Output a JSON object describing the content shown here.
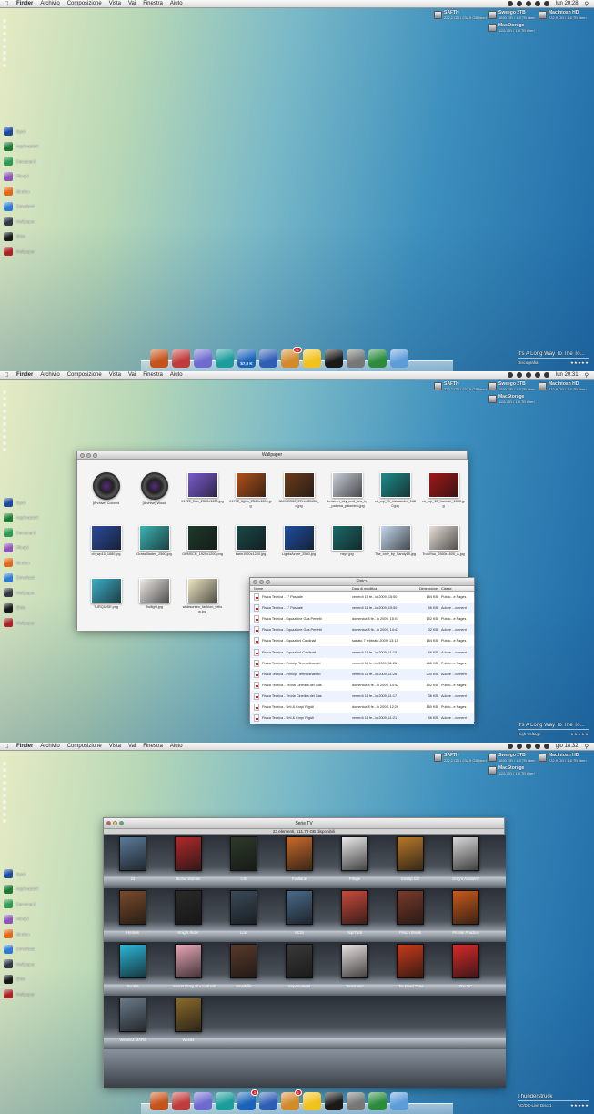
{
  "menubar": {
    "apple": "",
    "items": [
      "Finder",
      "Archivio",
      "Composizione",
      "Vista",
      "Vai",
      "Finestra",
      "Aiuto"
    ],
    "clocks": [
      "lun 20:28",
      "lun 20:31",
      "gio 18:32"
    ]
  },
  "drives": [
    {
      "name": "SAFTH",
      "info": "222,2 GB / 232,9 GB liberi"
    },
    {
      "name": "Sweego 2TB",
      "info": "1850 GB / 1,8 TB liberi"
    },
    {
      "name": "Macintosh HD",
      "info": "232,9 GB / 1,6 TB liberi"
    },
    {
      "name": "MacStorage",
      "info": "1111 GB / 1,8 TB liberi"
    }
  ],
  "sidebar": [
    {
      "label": "Spot!",
      "color": "#1c4a9c"
    },
    {
      "label": "Applicazioni",
      "color": "#1d7a34"
    },
    {
      "label": "Documenti",
      "color": "#2c9c52"
    },
    {
      "label": "Filmati",
      "color": "#8a55b8"
    },
    {
      "label": "Musica",
      "color": "#e06a1c"
    },
    {
      "label": "Download",
      "color": "#2e7bd0"
    },
    {
      "label": "Wallpaper",
      "color": "#333844"
    },
    {
      "label": "Slots",
      "color": "#161616"
    },
    {
      "label": "Wallpaper",
      "color": "#b22222"
    }
  ],
  "dock": {
    "s1_label": "$7,0 K",
    "badge_a": "31",
    "badge_b": "3",
    "badge_c": "1",
    "colors": [
      "#c4531c",
      "#c23b3b",
      "#6e6ad0",
      "#1b9d9b",
      "#1a63b9",
      "#2f5fb5",
      "#d28a2c",
      "#f2c21b",
      "#1a1a1a",
      "#777777",
      "#2c8c3c",
      "#5c9cd8"
    ]
  },
  "music": [
    {
      "title": "It's A Long Way To The To...",
      "artist": "Discografia"
    },
    {
      "title": "It's A Long Way To The To...",
      "artist": "High Voltage"
    },
    {
      "title": "Thunderstruck",
      "artist": "AC/DC-Live Disc 1"
    }
  ],
  "wallpaper_window": {
    "title": "Wallpaper",
    "items": [
      {
        "name": "[Archive] Colored",
        "color": "lens"
      },
      {
        "name": "[Archive] Wood",
        "color": "lens"
      },
      {
        "name": "01721_flow_2560x1600.jpg",
        "color": "#7a5bd0"
      },
      {
        "name": "01792_lights_2560x1600.jpg",
        "color": "#b0501a"
      },
      {
        "name": "384949562_57eb480d54_o.jpg",
        "color": "#6a3c1c"
      },
      {
        "name": "Between_sky_and_sea_by_paloma_palomino.jpg",
        "color": "#c9cfd8"
      },
      {
        "name": "cb_wp_11_cassandra_1680.jpg",
        "color": "#1f8c8c"
      },
      {
        "name": "cb_wp_12_hannah_1680.jpg",
        "color": "#a01818"
      },
      {
        "name": "cb_wp15_1680.jpg",
        "color": "#2a4a9c"
      },
      {
        "name": "GrassBlades_2560.jpg",
        "color": "#3bb5b5"
      },
      {
        "name": "GRNSCR_1920x1200.png",
        "color": "#1d3a2a"
      },
      {
        "name": "karin1920x1200.jpg",
        "color": "#1a4848"
      },
      {
        "name": "LightsAzure_2560.jpg",
        "color": "#1e4ea0"
      },
      {
        "name": "nsye.jpg",
        "color": "#1a6a6a"
      },
      {
        "name": "The_only_by_Sandy15.jpg",
        "color": "#c4d8ec"
      },
      {
        "name": "TrustYou_2560x1600_A.jpg",
        "color": "#e8e0d8"
      },
      {
        "name": "TURQUISE.png",
        "color": "#3cb0c8"
      },
      {
        "name": "Twilight.jpg",
        "color": "#f0ece8"
      },
      {
        "name": "widescreen_fashion_yellow.jpg",
        "color": "#efe8c4"
      }
    ]
  },
  "fisica_window": {
    "title": "Fisica",
    "headers": [
      "Nome",
      "Data di modifica",
      "Dimensione",
      "Classe"
    ],
    "rows": [
      [
        "Fisica Teorica - 1° Parziale",
        "venerdì 13 fe...io 2009, 15:50",
        "184 KB",
        "Public...e Pages"
      ],
      [
        "Fisica Teorica - 1° Parziale",
        "venerdì 13 fe...io 2009, 15:50",
        "56 KB",
        "Adobe ...cument"
      ],
      [
        "Fisica Teorica - Equazione Gas Perfetti",
        "domenica 8 fe...io 2009, 15:01",
        "152 KB",
        "Public...e Pages"
      ],
      [
        "Fisica Teorica - Equazione Gas Perfetti",
        "domenica 8 fe...io 2009, 14:47",
        "32 KB",
        "Adobe ...cument"
      ],
      [
        "Fisica Teorica - Equazioni Cardinali",
        "sabato 7 febbraio 2009, 13:13",
        "184 KB",
        "Public...e Pages"
      ],
      [
        "Fisica Teorica - Equazioni Cardinali",
        "venerdì 13 fe...io 2009, 11:15",
        "56 KB",
        "Adobe ...cument"
      ],
      [
        "Fisica Teorica - Principi Termodinamici",
        "venerdì 13 fe...io 2009, 11:26",
        "468 KB",
        "Public...e Pages"
      ],
      [
        "Fisica Teorica - Principi Termodinamici",
        "venerdì 13 fe...io 2009, 11:26",
        "200 KB",
        "Adobe ...cument"
      ],
      [
        "Fisica Teorica - Teoria Cinetica dei Gas",
        "domenica 8 fe...io 2009, 14:42",
        "152 KB",
        "Public...e Pages"
      ],
      [
        "Fisica Teorica - Teoria Cinetica dei Gas",
        "venerdì 13 fe...io 2009, 11:17",
        "36 KB",
        "Adobe ...cument"
      ],
      [
        "Fisica Teorica - Urti & Corpi Rigidi",
        "domenica 8 fe...io 2009, 12:26",
        "180 KB",
        "Public...e Pages"
      ],
      [
        "Fisica Teorica - Urti & Corpi Rigidi",
        "venerdì 13 fe...io 2009, 11:21",
        "56 KB",
        "Adobe ...cument"
      ]
    ]
  },
  "serie_window": {
    "title": "Serie TV",
    "status": "23 elementi, 511,78 GB disponibili",
    "items": [
      {
        "name": "24",
        "color": "#5a7a9a"
      },
      {
        "name": "Bionic Woman",
        "color": "#b02a2a"
      },
      {
        "name": "CSI",
        "color": "#2e3a2a"
      },
      {
        "name": "Fastlane",
        "color": "#c86a2a"
      },
      {
        "name": "Fringe",
        "color": "#e8e8e8"
      },
      {
        "name": "Gossip Girl",
        "color": "#b8782a"
      },
      {
        "name": "Grey's Anatomy",
        "color": "#d8d8d8"
      },
      {
        "name": "Heroes",
        "color": "#7a4a2a"
      },
      {
        "name": "Knight Rider",
        "color": "#2a2a2a"
      },
      {
        "name": "Lost",
        "color": "#3a4a5a"
      },
      {
        "name": "NCIS",
        "color": "#4a6a8a"
      },
      {
        "name": "Nip/Tuck",
        "color": "#c84a3a"
      },
      {
        "name": "Prison Break",
        "color": "#7a3a2a"
      },
      {
        "name": "Private Practice",
        "color": "#c85a1a"
      },
      {
        "name": "Scrubs",
        "color": "#2ab8d8"
      },
      {
        "name": "Secret Diary of a Call Girl",
        "color": "#e8a8b8"
      },
      {
        "name": "Smallville",
        "color": "#5a3a2a"
      },
      {
        "name": "Supernatural",
        "color": "#3a3a3a"
      },
      {
        "name": "Terminator",
        "color": "#e8e0e0"
      },
      {
        "name": "The Dead Zone",
        "color": "#c83a1a"
      },
      {
        "name": "The OC",
        "color": "#d82a2a"
      },
      {
        "name": "Veronica MARS",
        "color": "#6a7a8a"
      },
      {
        "name": "Weeds",
        "color": "#8a6a2a"
      }
    ]
  }
}
